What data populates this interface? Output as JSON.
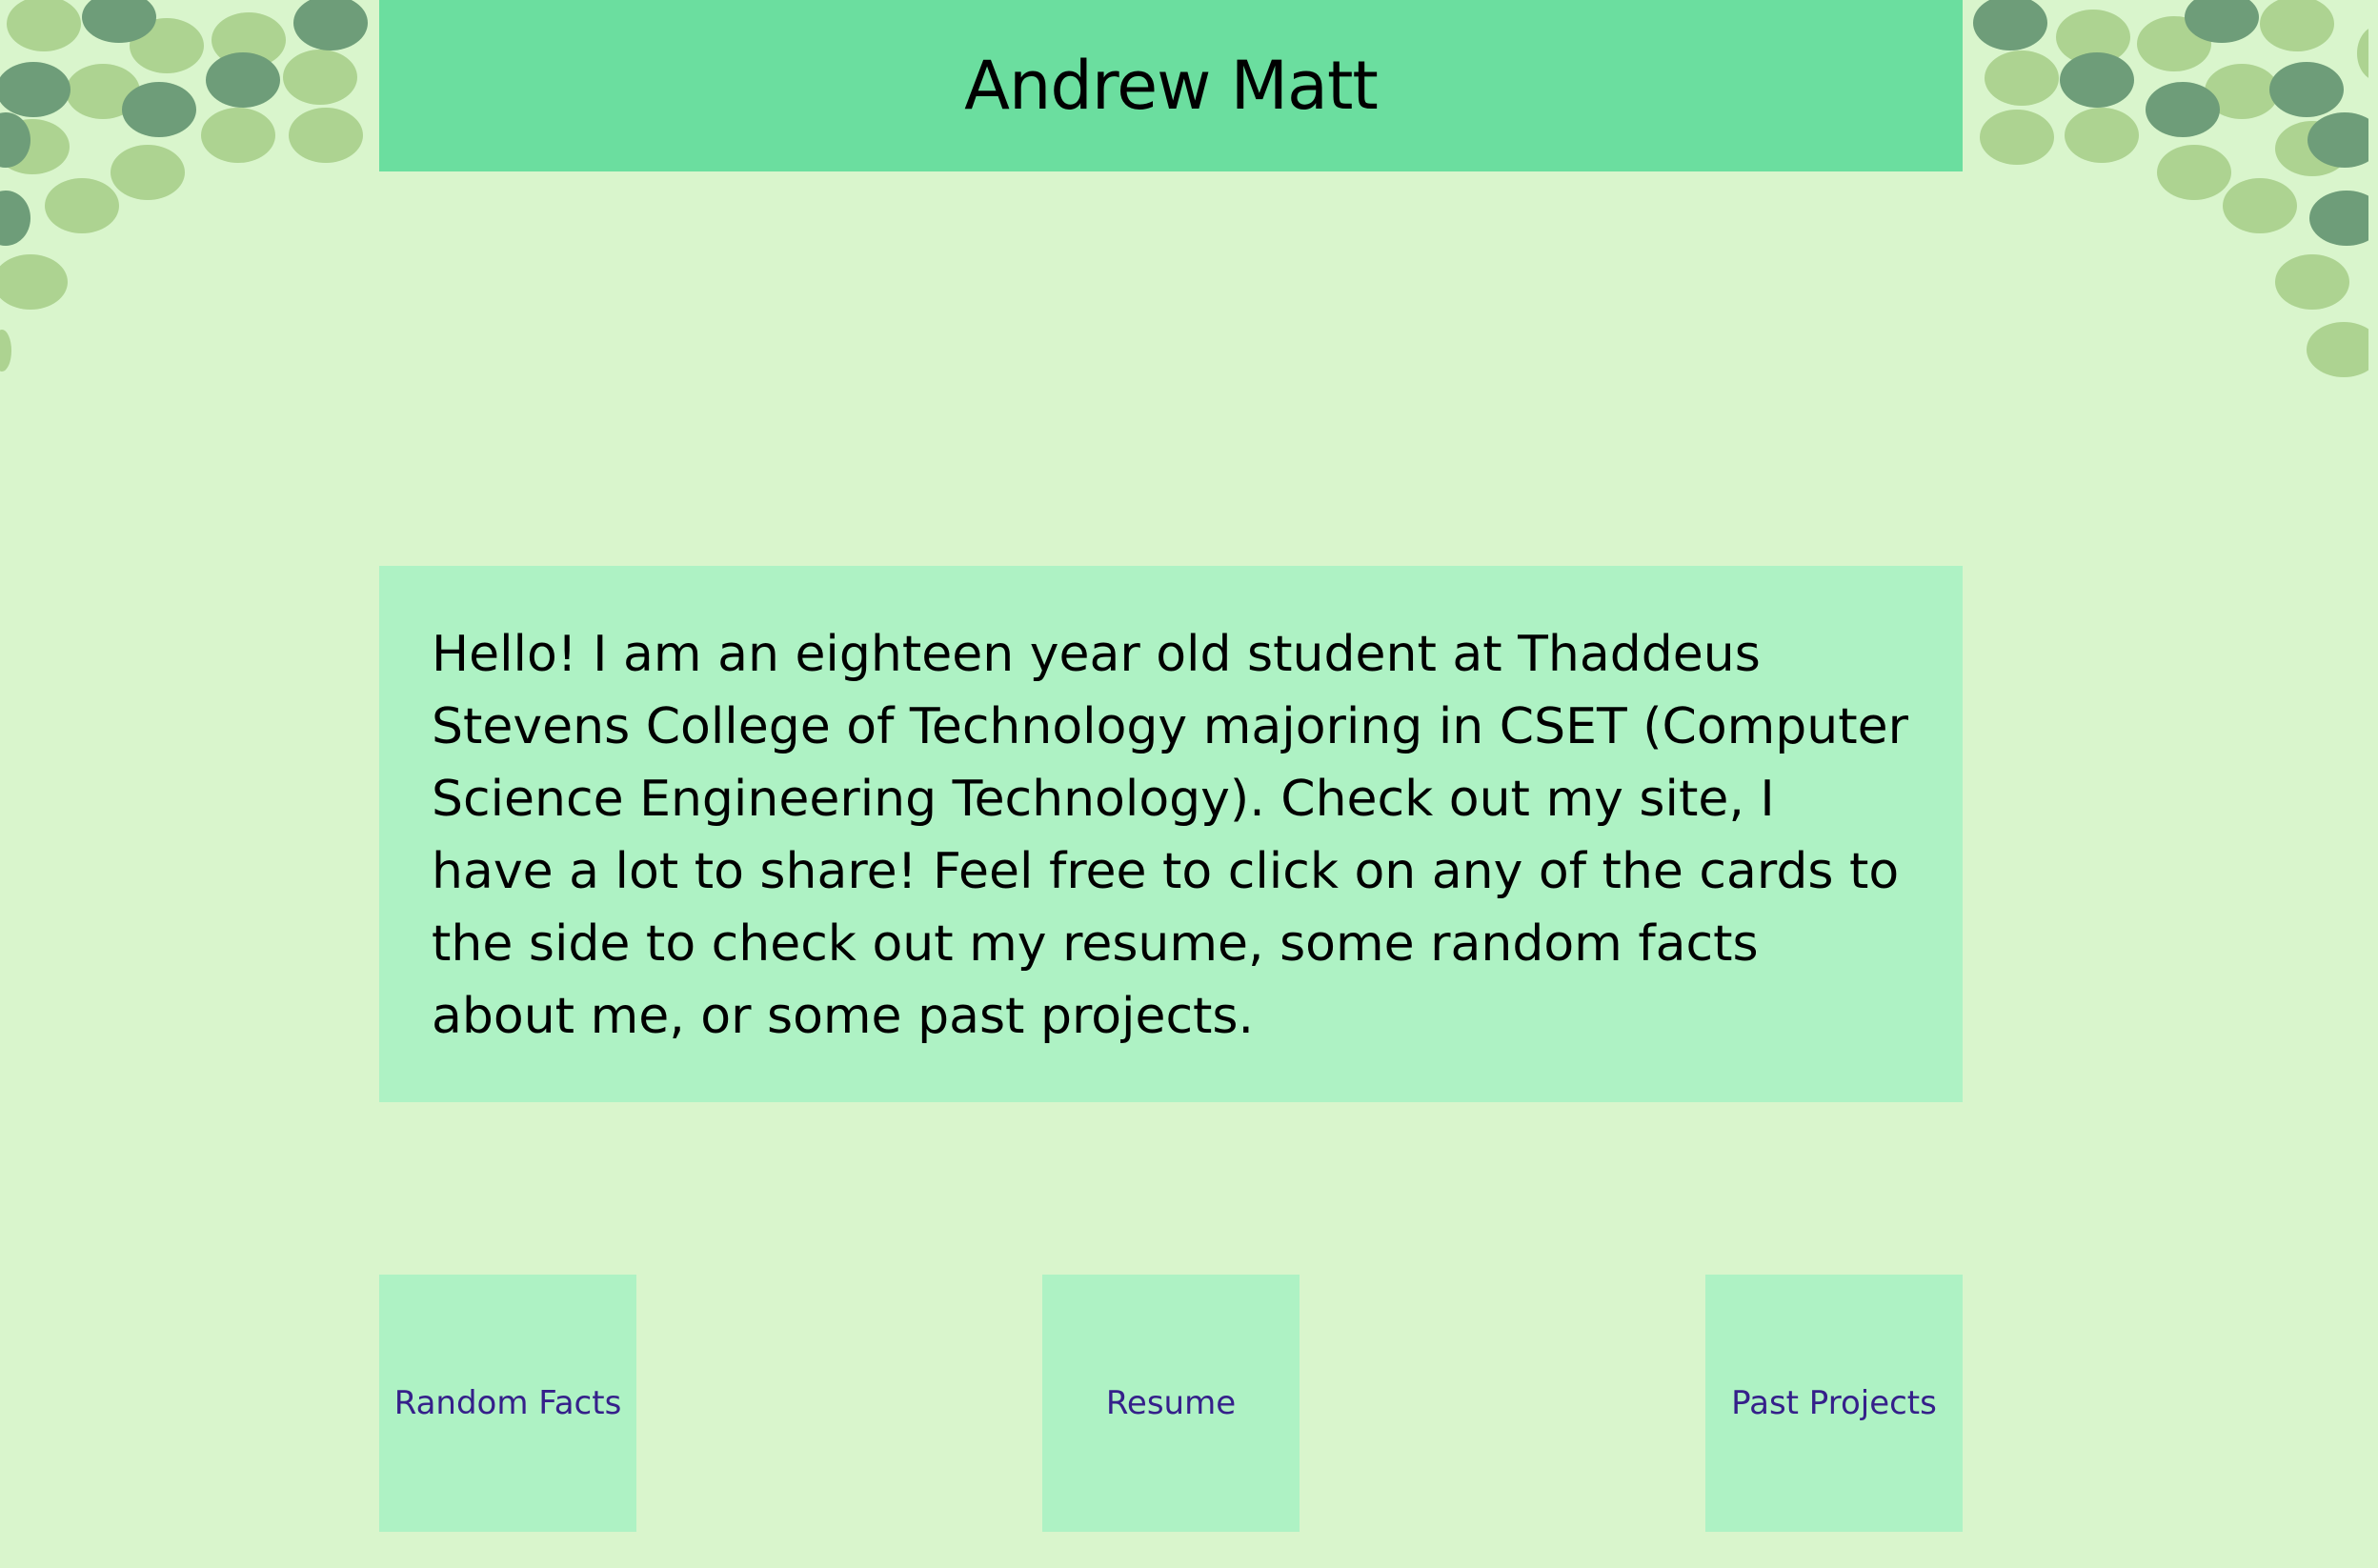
{
  "header": {
    "title": "Andrew Matt"
  },
  "intro": {
    "text": "Hello! I am an eighteen year old student at Thaddeus Stevens College of Technology majoring in CSET (Computer Science Engineering Technology). Check out my site, I have a lot to share! Feel free to click on any of the cards to the side to check out my resume, some random facts about me, or some past projects."
  },
  "cards": [
    {
      "label": "Random Facts"
    },
    {
      "label": "Resume"
    },
    {
      "label": "Past Projects"
    }
  ],
  "colors": {
    "background": "#d9f5cc",
    "header": "#6bde9f",
    "panel": "#aef2c4",
    "link": "#35208a",
    "dot_light": "#add391",
    "dot_dark": "#6e9d79"
  }
}
